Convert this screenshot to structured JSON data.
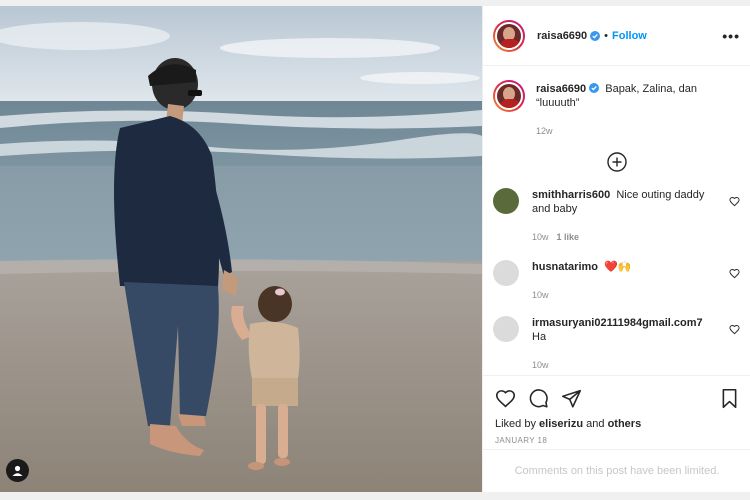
{
  "post": {
    "username": "raisa6690",
    "follow_label": "Follow",
    "more_label": "•••",
    "caption": "Bapak, Zalina, dan “luuuuth”",
    "caption_time": "12w"
  },
  "comments": [
    {
      "username": "smithharris600",
      "text": "Nice outing daddy and baby",
      "time": "10w",
      "likes": "1 like"
    },
    {
      "username": "husnatarimo",
      "text": "❤️🙌",
      "time": "10w"
    },
    {
      "username": "irmasuryani02111984gmail.com7",
      "text": "Ha",
      "time": "10w"
    }
  ],
  "actions": {
    "liked_by_prefix": "Liked by",
    "liked_by_user": "eliserizu",
    "liked_by_and": "and",
    "liked_by_others": "others",
    "date": "JANUARY 18"
  },
  "comments_limited": "Comments on this post have been limited.",
  "icons": {
    "verified": "verified-badge-icon",
    "load_more": "plus-circle-icon",
    "like": "heart-icon",
    "comment": "comment-icon",
    "share": "send-icon",
    "save": "bookmark-icon",
    "user_tag": "user-tag-icon"
  },
  "colors": {
    "accent": "#0095f6",
    "verified": "#3897f0",
    "text": "#262626",
    "muted": "#8e8e8e"
  }
}
